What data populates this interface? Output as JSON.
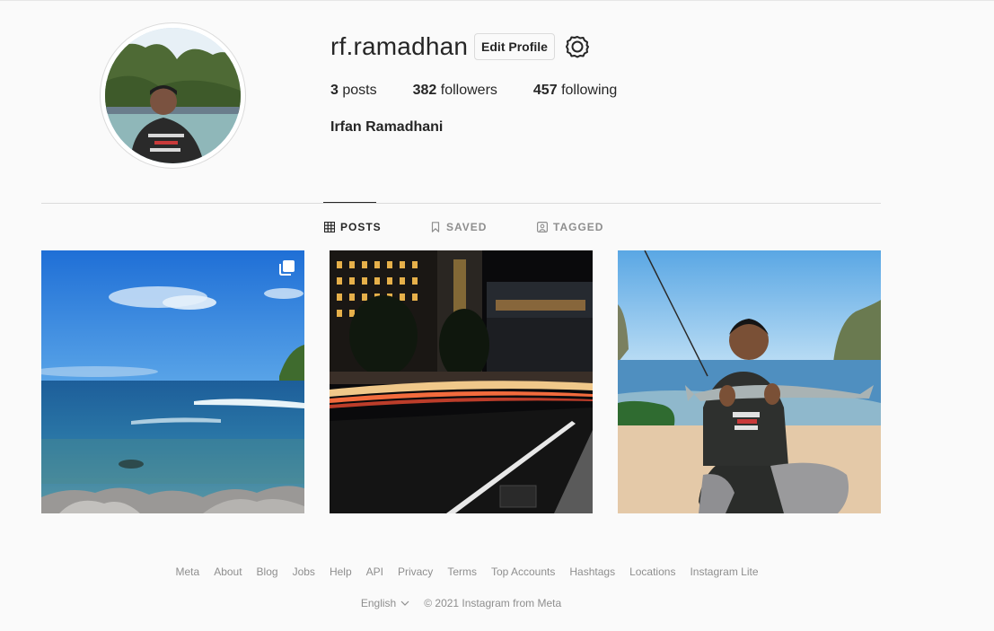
{
  "profile": {
    "username": "rf.ramadhan",
    "edit_label": "Edit Profile",
    "full_name": "Irfan Ramadhani",
    "stats": {
      "posts_count": "3",
      "posts_label": "posts",
      "followers_count": "382",
      "followers_label": "followers",
      "following_count": "457",
      "following_label": "following"
    }
  },
  "tabs": [
    {
      "label": "POSTS",
      "icon": "grid-icon",
      "active": true
    },
    {
      "label": "SAVED",
      "icon": "bookmark-icon",
      "active": false
    },
    {
      "label": "TAGGED",
      "icon": "tag-icon",
      "active": false
    }
  ],
  "posts": [
    {
      "subject": "beach-rocks",
      "multi": true
    },
    {
      "subject": "night-street-hotel",
      "multi": false
    },
    {
      "subject": "man-holding-fish",
      "multi": false
    }
  ],
  "footer": {
    "links": [
      "Meta",
      "About",
      "Blog",
      "Jobs",
      "Help",
      "API",
      "Privacy",
      "Terms",
      "Top Accounts",
      "Hashtags",
      "Locations",
      "Instagram Lite"
    ],
    "language": "English",
    "copyright": "© 2021 Instagram from Meta"
  },
  "colors": {
    "text": "#262626",
    "muted": "#8e8e8e",
    "border": "#dbdbdb",
    "background": "#fafafa"
  }
}
